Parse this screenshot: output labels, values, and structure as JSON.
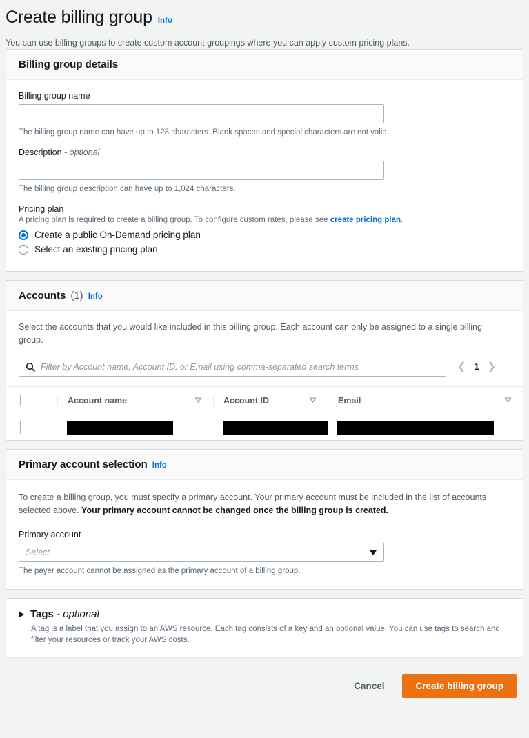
{
  "page": {
    "title": "Create billing group",
    "info_label": "Info",
    "description": "You can use billing groups to create custom account groupings where you can apply custom pricing plans."
  },
  "colors": {
    "link": "#0972d3",
    "primary_button": "#ec7211",
    "page_background": "#f2f3f3",
    "card_background": "#ffffff",
    "redaction": "#000000"
  },
  "details": {
    "title": "Billing group details",
    "name_field": {
      "label": "Billing group name",
      "value": "",
      "placeholder": "",
      "hint": "The billing group name can have up to 128 characters. Blank spaces and special characters are not valid."
    },
    "description_field": {
      "label": "Description",
      "optional_suffix": "- optional",
      "value": "",
      "placeholder": "",
      "hint": "The billing group description can have up to 1,024 characters."
    },
    "pricing_plan": {
      "label": "Pricing plan",
      "sub_text_before_link": "A pricing plan is required to create a billing group. To configure custom rates, please see ",
      "link_text": "create pricing plan",
      "sub_text_after_link": ".",
      "options": [
        {
          "label": "Create a public On-Demand pricing plan",
          "selected": true
        },
        {
          "label": "Select an existing pricing plan",
          "selected": false
        }
      ]
    }
  },
  "accounts": {
    "title": "Accounts",
    "count": "(1)",
    "info_label": "Info",
    "description": "Select the accounts that you would like included in this billing group. Each account can only be assigned to a single billing group.",
    "search": {
      "placeholder": "Filter by Account name, Account ID, or Email using comma-separated search terms",
      "value": "",
      "icon": "search-icon"
    },
    "pagination": {
      "previous_icon": "chevron-left-icon",
      "next_icon": "chevron-right-icon",
      "current_page": "1"
    },
    "table": {
      "columns": [
        {
          "label": "Account name",
          "sort_icon": "sort-descending-icon"
        },
        {
          "label": "Account ID",
          "sort_icon": "sort-descending-icon"
        },
        {
          "label": "Email",
          "sort_icon": "sort-descending-icon"
        }
      ],
      "rows": [
        {
          "selected": false,
          "account_name": "",
          "account_id": "",
          "email": "",
          "redacted": true
        }
      ]
    }
  },
  "primary_account": {
    "title": "Primary account selection",
    "info_label": "Info",
    "description_part1": "To create a billing group, you must specify a primary account. Your primary account must be included in the list of accounts selected above. ",
    "description_bold": "Your primary account cannot be changed once the billing group is created.",
    "field": {
      "label": "Primary account",
      "placeholder": "Select",
      "value": "",
      "caret_icon": "chevron-down-icon",
      "hint": "The payer account cannot be assigned as the primary account of a billing group."
    }
  },
  "tags": {
    "expander_icon": "triangle-right-icon",
    "title": "Tags",
    "optional_suffix": "- optional",
    "expanded": false,
    "description": "A tag is a label that you assign to an AWS resource. Each tag consists of a key and an optional value. You can use tags to search and filter your resources or track your AWS costs."
  },
  "footer": {
    "cancel_label": "Cancel",
    "submit_label": "Create billing group"
  }
}
